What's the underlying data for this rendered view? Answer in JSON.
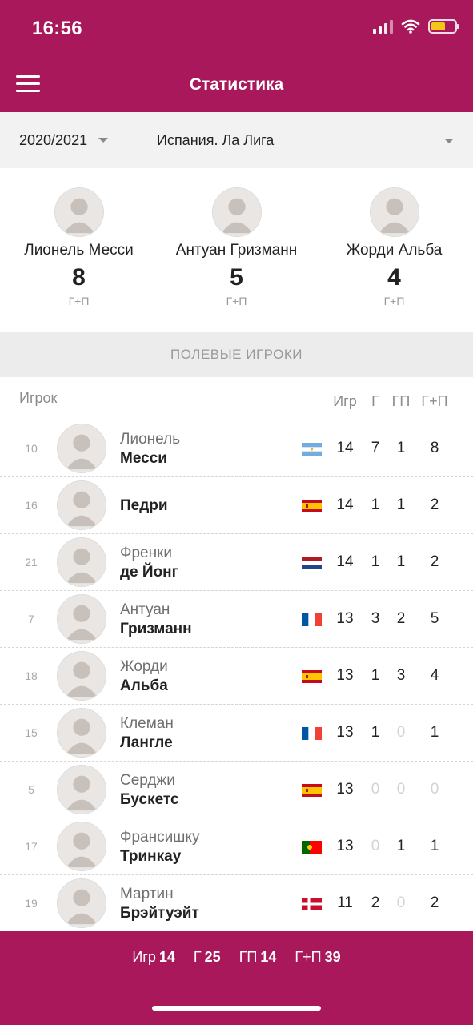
{
  "status_bar": {
    "time": "16:56"
  },
  "app_bar": {
    "title": "Статистика"
  },
  "filters": {
    "season": "2020/2021",
    "league": "Испания. Ла Лига"
  },
  "leaders": [
    {
      "name": "Лионель Месси",
      "value": "8",
      "metric": "Г+П"
    },
    {
      "name": "Антуан Гризманн",
      "value": "5",
      "metric": "Г+П"
    },
    {
      "name": "Жорди Альба",
      "value": "4",
      "metric": "Г+П"
    }
  ],
  "section": {
    "title": "ПОЛЕВЫЕ ИГРОКИ"
  },
  "columns": {
    "player": "Игрок",
    "games": "Игр",
    "goals": "Г",
    "assists": "ГП",
    "total": "Г+П"
  },
  "players": [
    {
      "number": "10",
      "first": "Лионель",
      "last": "Месси",
      "flag": "argentina-flag",
      "games": "14",
      "goals": "7",
      "assists": "1",
      "total": "8"
    },
    {
      "number": "16",
      "first": "",
      "last": "Педри",
      "flag": "spain-flag",
      "games": "14",
      "goals": "1",
      "assists": "1",
      "total": "2"
    },
    {
      "number": "21",
      "first": "Френки",
      "last": "де Йонг",
      "flag": "netherlands-flag",
      "games": "14",
      "goals": "1",
      "assists": "1",
      "total": "2"
    },
    {
      "number": "7",
      "first": "Антуан",
      "last": "Гризманн",
      "flag": "france-flag",
      "games": "13",
      "goals": "3",
      "assists": "2",
      "total": "5"
    },
    {
      "number": "18",
      "first": "Жорди",
      "last": "Альба",
      "flag": "spain-flag",
      "games": "13",
      "goals": "1",
      "assists": "3",
      "total": "4"
    },
    {
      "number": "15",
      "first": "Клеман",
      "last": "Лангле",
      "flag": "france-flag",
      "games": "13",
      "goals": "1",
      "assists": "0",
      "total": "1"
    },
    {
      "number": "5",
      "first": "Серджи",
      "last": "Бускетс",
      "flag": "spain-flag",
      "games": "13",
      "goals": "0",
      "assists": "0",
      "total": "0"
    },
    {
      "number": "17",
      "first": "Франсишку",
      "last": "Тринкау",
      "flag": "portugal-flag",
      "games": "13",
      "goals": "0",
      "assists": "1",
      "total": "1"
    },
    {
      "number": "19",
      "first": "Мартин",
      "last": "Брэйтуэйт",
      "flag": "denmark-flag",
      "games": "11",
      "goals": "2",
      "assists": "0",
      "total": "2"
    }
  ],
  "totals": {
    "games_label": "Игр",
    "games": "14",
    "goals_label": "Г",
    "goals": "25",
    "assists_label": "ГП",
    "assists": "14",
    "total_label": "Г+П",
    "total": "39"
  },
  "colors": {
    "brand": "#a8185a",
    "filter_bg": "#f2f2f2",
    "section_bg": "#ececec"
  }
}
